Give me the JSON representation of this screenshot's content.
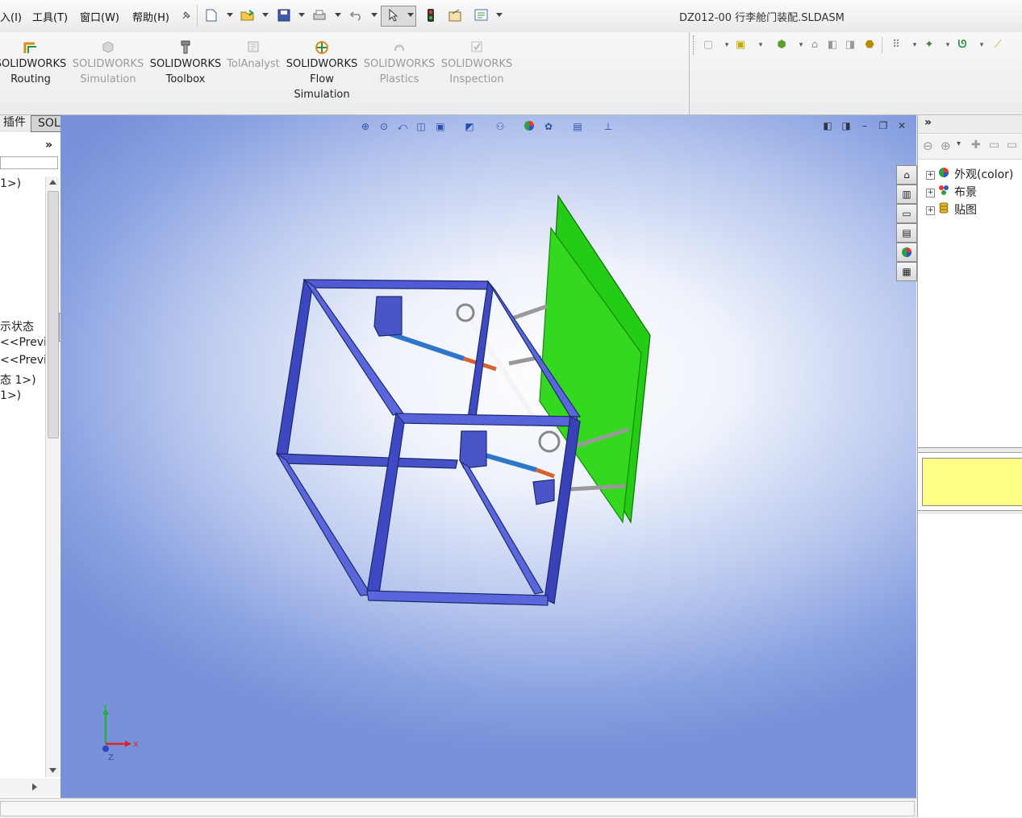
{
  "menu": {
    "items": [
      "入(I)",
      "工具(T)",
      "窗口(W)",
      "帮助(H)"
    ]
  },
  "window": {
    "title": "DZ012-00 行李舱门装配.SLDASM"
  },
  "ribbon": {
    "buttons": [
      {
        "line1": "SOLIDWORKS",
        "line2": "Routing",
        "line3": "",
        "enabled": true
      },
      {
        "line1": "SOLIDWORKS",
        "line2": "Simulation",
        "line3": "",
        "enabled": false
      },
      {
        "line1": "SOLIDWORKS",
        "line2": "Toolbox",
        "line3": "",
        "enabled": true
      },
      {
        "line1": "TolAnalyst",
        "line2": "",
        "line3": "",
        "enabled": false
      },
      {
        "line1": "SOLIDWORKS",
        "line2": "Flow",
        "line3": "Simulation",
        "enabled": true
      },
      {
        "line1": "SOLIDWORKS",
        "line2": "Plastics",
        "line3": "",
        "enabled": false
      },
      {
        "line1": "SOLIDWORKS",
        "line2": "Inspection",
        "line3": "",
        "enabled": false
      }
    ]
  },
  "tabs": {
    "plugins": "插件",
    "mbd": "SOLIDWORKS MBD"
  },
  "feature_tree": {
    "lines": [
      {
        "text": "1>)"
      },
      {
        "text": "示状态"
      },
      {
        "text": "<<Previ"
      },
      {
        "text": "<<Previ"
      },
      {
        "text": "态 1>)"
      },
      {
        "text": "1>)"
      }
    ]
  },
  "task_pane": {
    "items": [
      "外观(color)",
      "布景",
      "贴图"
    ]
  },
  "triad": {
    "x": "X",
    "y": "Y",
    "z": "Z"
  }
}
